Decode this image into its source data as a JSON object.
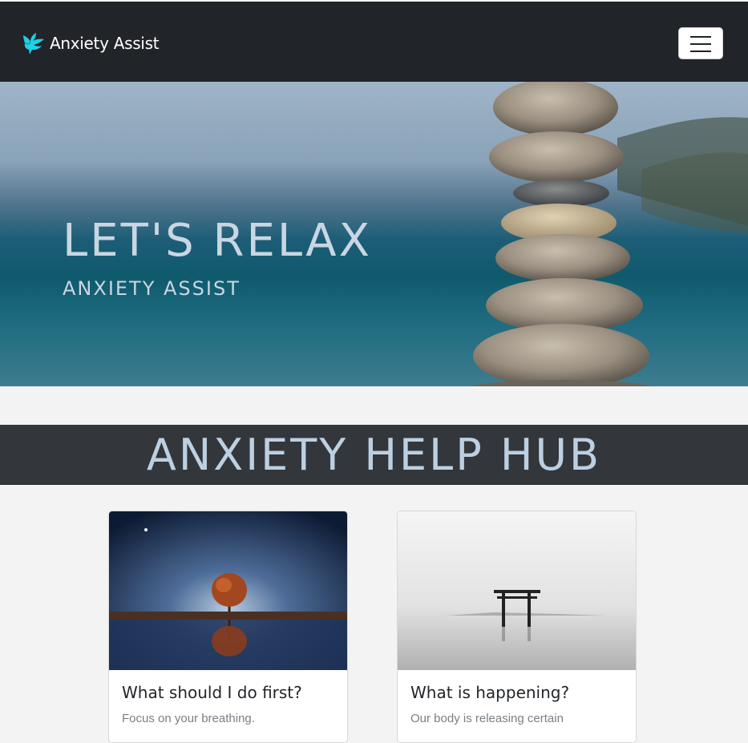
{
  "navbar": {
    "brand": "Anxiety Assist",
    "menu_icon": "hamburger-menu-icon"
  },
  "hero": {
    "title": "LET'S RELAX",
    "subtitle": "ANXIETY ASSIST"
  },
  "hub": {
    "title": "ANXIETY HELP HUB"
  },
  "cards": [
    {
      "title": "What should I do first?",
      "text": "Focus on your breathing."
    },
    {
      "title": "What is happening?",
      "text": "Our body is releasing certain"
    }
  ],
  "colors": {
    "navbar": "#212429",
    "hub_banner": "#33363b",
    "hero_text": "#c9d6e3",
    "brand_icon": "#1fd0e6"
  }
}
